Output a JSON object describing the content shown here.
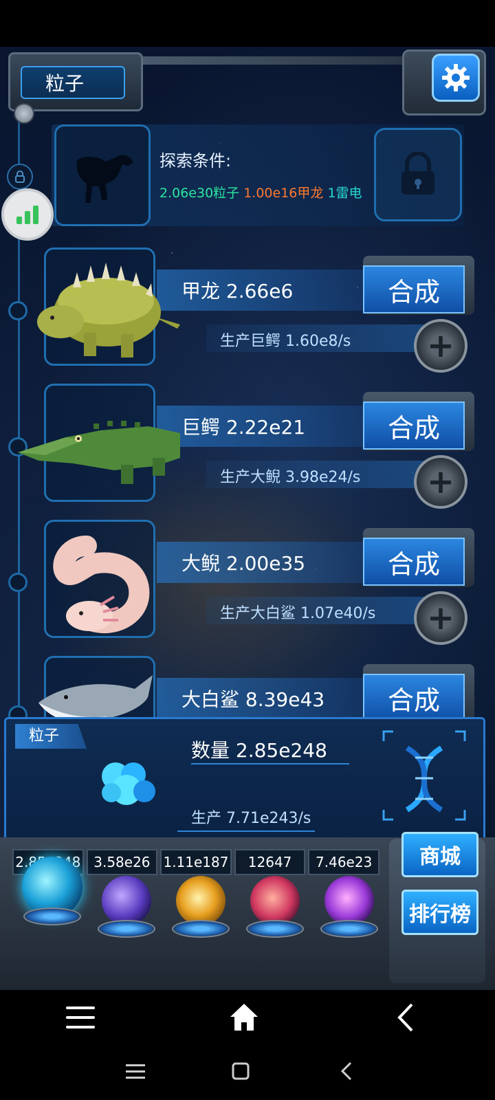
{
  "header": {
    "title": "粒子"
  },
  "explore": {
    "label": "探索条件:",
    "req_1": "2.06e30粒子",
    "req_2": "1.00e16甲龙",
    "req_3": "1雷电"
  },
  "creatures": [
    {
      "name": "甲龙 2.66e6",
      "production": "生产巨鳄 1.60e8/s",
      "synth_label": "合成",
      "icon": "ankylosaurus"
    },
    {
      "name": "巨鳄 2.22e21",
      "production": "生产大鲵 3.98e24/s",
      "synth_label": "合成",
      "icon": "crocodile"
    },
    {
      "name": "大鲵 2.00e35",
      "production": "生产大白鲨 1.07e40/s",
      "synth_label": "合成",
      "icon": "axolotl"
    },
    {
      "name": "大白鲨 8.39e43",
      "production": "",
      "synth_label": "合成",
      "icon": "shark"
    }
  ],
  "particle": {
    "tag": "粒子",
    "count": "数量 2.85e248",
    "production": "生产 7.71e243/s"
  },
  "resources": [
    "2.85e248",
    "3.58e26",
    "1.11e187",
    "12647",
    "7.46e23"
  ],
  "side_buttons": {
    "shop": "商城",
    "ranking": "排行榜"
  },
  "colors": {
    "accent": "#2b86e0",
    "req_green": "#2ee6a0",
    "req_orange": "#ff7a2e",
    "req_cyan": "#29d6d0"
  }
}
